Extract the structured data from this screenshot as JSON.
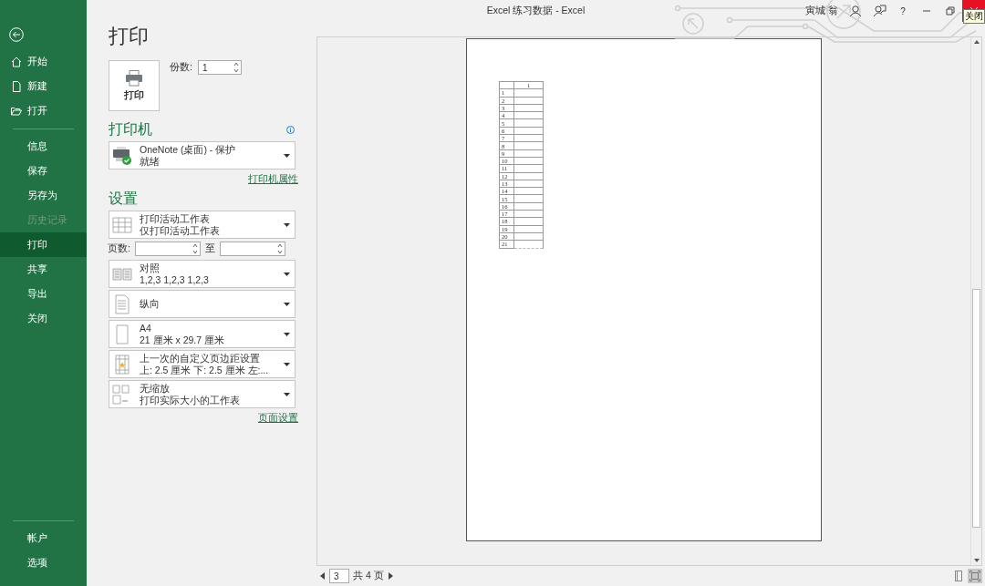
{
  "window": {
    "title": "Excel 练习数据  -  Excel",
    "user": "寅城 翁",
    "help": "?",
    "close_tooltip": "关闭"
  },
  "sidebar": {
    "items": [
      {
        "label": "开始",
        "selected": false,
        "disabled": false
      },
      {
        "label": "新建",
        "selected": false,
        "disabled": false
      },
      {
        "label": "打开",
        "selected": false,
        "disabled": false
      },
      {
        "label": "信息",
        "selected": false,
        "disabled": false
      },
      {
        "label": "保存",
        "selected": false,
        "disabled": false
      },
      {
        "label": "另存为",
        "selected": false,
        "disabled": false
      },
      {
        "label": "历史记录",
        "selected": false,
        "disabled": true
      },
      {
        "label": "打印",
        "selected": true,
        "disabled": false
      },
      {
        "label": "共享",
        "selected": false,
        "disabled": false
      },
      {
        "label": "导出",
        "selected": false,
        "disabled": false
      },
      {
        "label": "关闭",
        "selected": false,
        "disabled": false
      }
    ],
    "footer_items": [
      {
        "label": "帐户",
        "selected": false,
        "disabled": false
      },
      {
        "label": "选项",
        "selected": false,
        "disabled": false
      }
    ]
  },
  "heading": "打印",
  "print_button": "打印",
  "copies": {
    "label": "份数:",
    "value": "1"
  },
  "printer": {
    "heading": "打印机",
    "name": "OneNote (桌面) - 保护",
    "status": "就绪",
    "properties_link": "打印机属性"
  },
  "settings": {
    "heading": "设置",
    "items": [
      {
        "kind": "dropdown",
        "title": "打印活动工作表",
        "subtitle": "仅打印活动工作表"
      },
      {
        "kind": "pages",
        "label": "页数:",
        "to": "至"
      },
      {
        "kind": "dropdown",
        "title": "对照",
        "subtitle": "1,2,3    1,2,3    1,2,3"
      },
      {
        "kind": "dropdown",
        "title": "纵向"
      },
      {
        "kind": "dropdown",
        "title": "A4",
        "subtitle": "21 厘米 x 29.7 厘米"
      },
      {
        "kind": "dropdown",
        "title": "上一次的自定义页边距设置",
        "subtitle": "上: 2.5 厘米 下: 2.5 厘米 左:..."
      },
      {
        "kind": "dropdown",
        "title": "无缩放",
        "subtitle": "打印实际大小的工作表"
      }
    ],
    "page_setup_link": "页面设置"
  },
  "preview": {
    "column_header": "1",
    "row_numbers": [
      "1",
      "2",
      "3",
      "4",
      "5",
      "6",
      "7",
      "8",
      "9",
      "10",
      "11",
      "12",
      "13",
      "14",
      "15",
      "16",
      "17",
      "18",
      "19",
      "20",
      "21"
    ],
    "current_page": "3",
    "total_pages": "共 4 页",
    "view_buttons": [
      {
        "selected": false
      },
      {
        "selected": true
      }
    ]
  }
}
